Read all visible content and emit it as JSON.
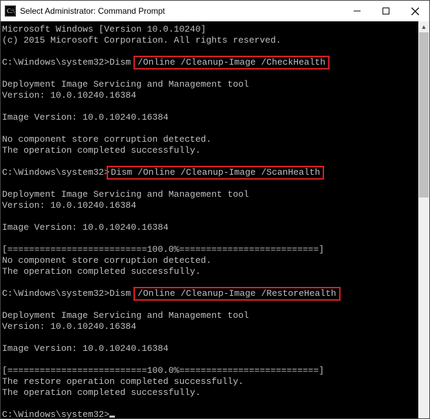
{
  "window": {
    "title": "Select Administrator: Command Prompt"
  },
  "term": {
    "banner1": "Microsoft Windows [Version 10.0.10240]",
    "banner2": "(c) 2015 Microsoft Corporation. All rights reserved.",
    "prompt": "C:\\Windows\\system32>",
    "cmd1_pre": "Dism ",
    "cmd1_hl": "/Online /Cleanup-Image /CheckHealth",
    "tool1": "Deployment Image Servicing and Management tool",
    "ver1": "Version: 10.0.10240.16384",
    "imgver1": "Image Version: 10.0.10240.16384",
    "nocorrupt1": "No component store corruption detected.",
    "success1": "The operation completed successfully.",
    "cmd2_hl": "Dism /Online /Cleanup-Image /ScanHealth",
    "tool2": "Deployment Image Servicing and Management tool",
    "ver2": "Version: 10.0.10240.16384",
    "imgver2": "Image Version: 10.0.10240.16384",
    "progress2": "[==========================100.0%==========================]",
    "nocorrupt2": "No component store corruption detected.",
    "success2": "The operation completed successfully.",
    "cmd3_pre": "Dism ",
    "cmd3_hl": "/Online /Cleanup-Image /RestoreHealth",
    "tool3": "Deployment Image Servicing and Management tool",
    "ver3": "Version: 10.0.10240.16384",
    "imgver3": "Image Version: 10.0.10240.16384",
    "progress3": "[==========================100.0%==========================]",
    "restore_success": "The restore operation completed successfully.",
    "success3": "The operation completed successfully."
  }
}
